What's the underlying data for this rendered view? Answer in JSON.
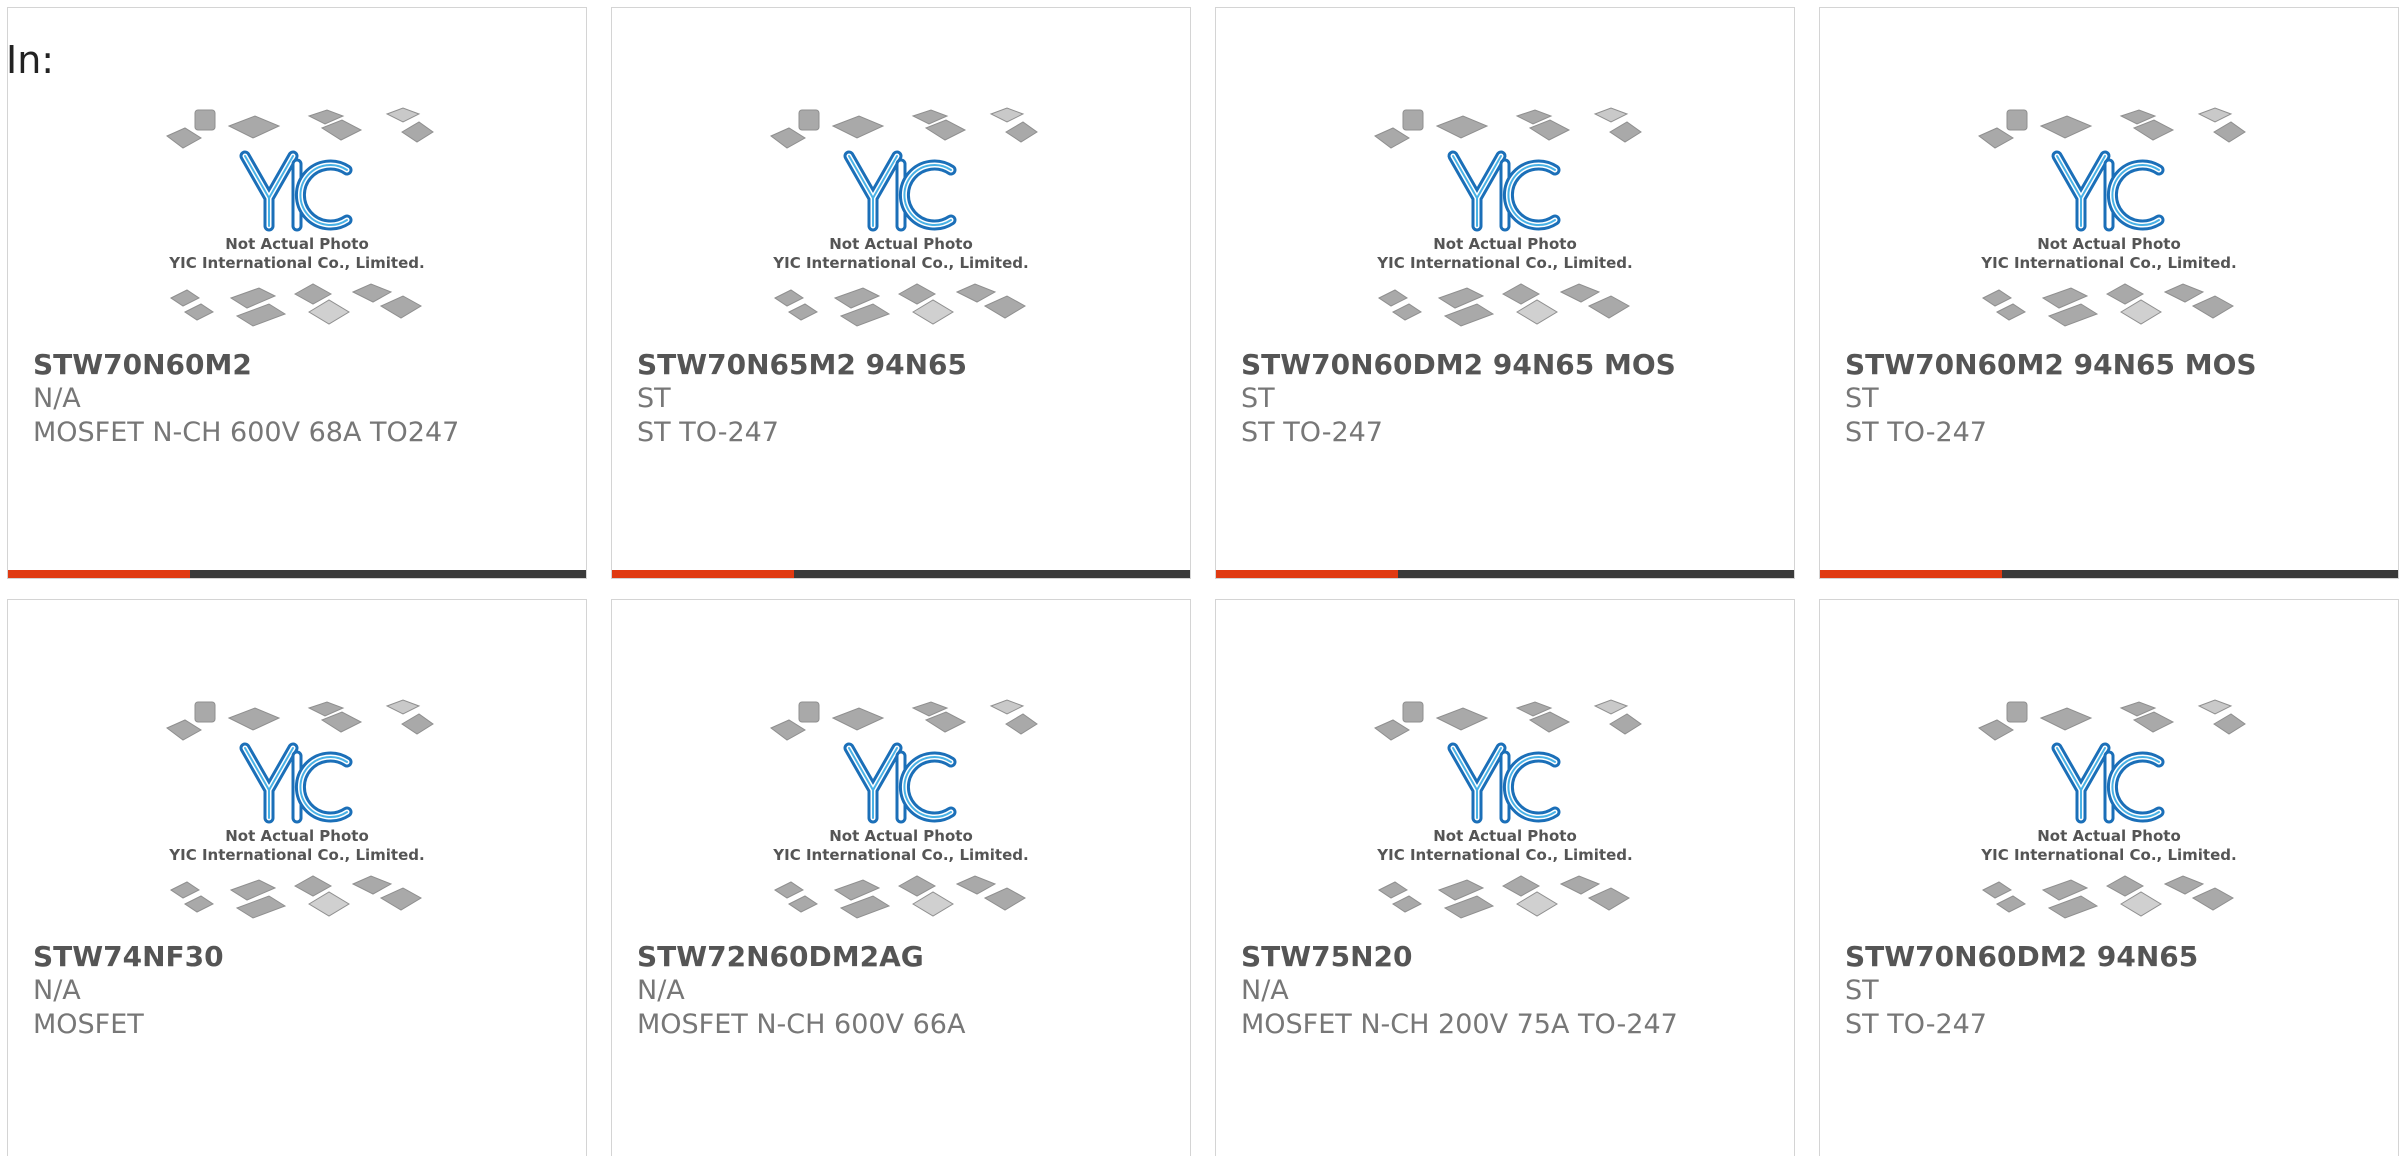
{
  "header": {
    "label": "In:"
  },
  "placeholder": {
    "line1": "Not Actual Photo",
    "line2": "YIC International Co., Limited.",
    "logo": "YIC"
  },
  "colors": {
    "accent": "#e03a12",
    "bar": "#3a3a3a",
    "logo": "#1e86c8"
  },
  "products": [
    {
      "part": "STW70N60M2",
      "mfr": "N/A",
      "desc": "MOSFET N-CH 600V 68A TO247"
    },
    {
      "part": "STW70N65M2 94N65",
      "mfr": "ST",
      "desc": "ST TO-247"
    },
    {
      "part": "STW70N60DM2 94N65 MOS",
      "mfr": "ST",
      "desc": "ST TO-247"
    },
    {
      "part": "STW70N60M2 94N65 MOS",
      "mfr": "ST",
      "desc": "ST TO-247"
    },
    {
      "part": "STW74NF30",
      "mfr": "N/A",
      "desc": "MOSFET"
    },
    {
      "part": "STW72N60DM2AG",
      "mfr": "N/A",
      "desc": "MOSFET N-CH 600V 66A"
    },
    {
      "part": "STW75N20",
      "mfr": "N/A",
      "desc": "MOSFET N-CH 200V 75A TO-247"
    },
    {
      "part": "STW70N60DM2 94N65",
      "mfr": "ST",
      "desc": "ST TO-247"
    }
  ]
}
